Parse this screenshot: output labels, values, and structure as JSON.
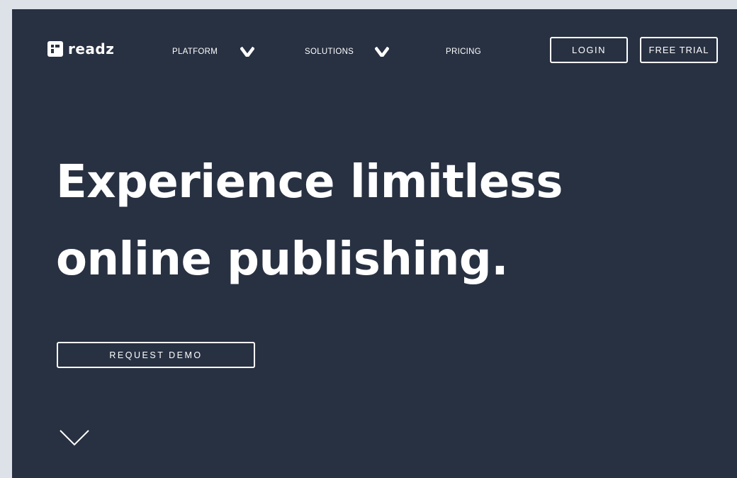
{
  "brand": {
    "name": "readz"
  },
  "nav": {
    "items": [
      {
        "label": "PLATFORM",
        "has_dropdown": true
      },
      {
        "label": "SOLUTIONS",
        "has_dropdown": true
      },
      {
        "label": "PRICING",
        "has_dropdown": false
      }
    ],
    "login_label": "LOGIN",
    "trial_label": "FREE TRIAL"
  },
  "hero": {
    "line1": "Experience limitless",
    "line2": "online publishing.",
    "cta_label": "REQUEST DEMO"
  },
  "colors": {
    "background": "#283142",
    "page_outer": "#dde1e8",
    "foreground": "#ffffff"
  },
  "icons": {
    "logo": "readz-logo-mark",
    "dropdown": "chevron-down-icon",
    "scroll": "scroll-down-chevron-icon"
  }
}
